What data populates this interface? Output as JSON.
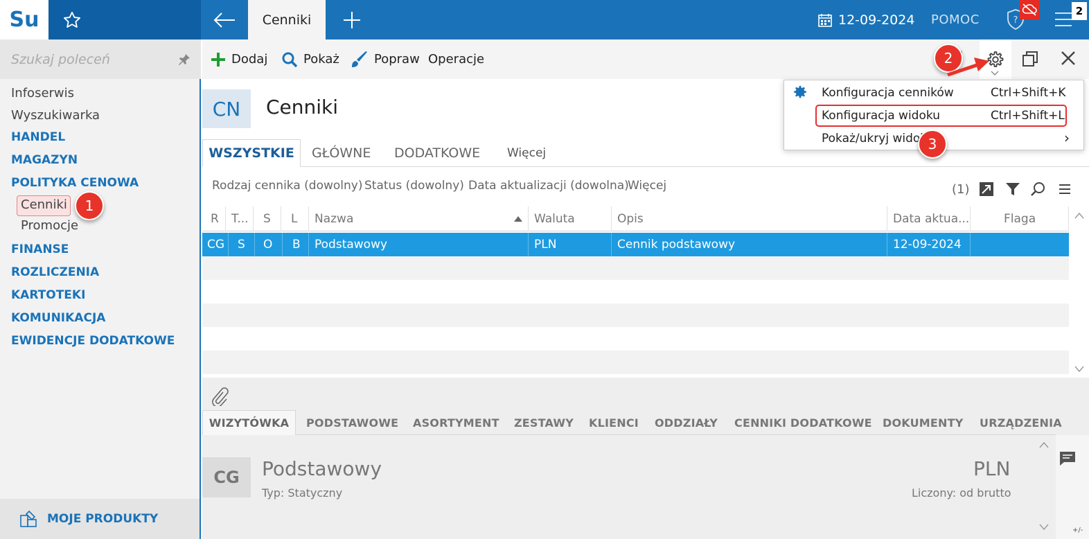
{
  "topbar": {
    "logo": "Su",
    "active_tab": "Cenniki",
    "date": "12-09-2024",
    "help": "POMOC",
    "badge_count": "2"
  },
  "sidebar": {
    "search_placeholder": "Szukaj poleceń",
    "items": [
      {
        "label": "Infoserwis"
      },
      {
        "label": "Wyszukiwarka"
      },
      {
        "label": "HANDEL"
      },
      {
        "label": "MAGAZYN"
      },
      {
        "label": "POLITYKA CENOWA"
      },
      {
        "label": "Cenniki"
      },
      {
        "label": "Promocje"
      },
      {
        "label": "FINANSE"
      },
      {
        "label": "ROZLICZENIA"
      },
      {
        "label": "KARTOTEKI"
      },
      {
        "label": "KOMUNIKACJA"
      },
      {
        "label": "EWIDENCJE DODATKOWE"
      }
    ],
    "products": "MOJE PRODUKTY"
  },
  "toolbar": {
    "add": "Dodaj",
    "show": "Pokaż",
    "edit": "Popraw",
    "operations": "Operacje"
  },
  "header": {
    "code": "CN",
    "title": "Cenniki"
  },
  "tabs": [
    "WSZYSTKIE",
    "GŁÓWNE",
    "DODATKOWE",
    "Więcej"
  ],
  "filters": {
    "items": [
      "Rodzaj cennika (dowolny)",
      "Status (dowolny)",
      "Data aktualizacji (dowolna)",
      "Więcej"
    ],
    "count": "(1)"
  },
  "grid": {
    "columns": [
      "R",
      "T...",
      "S",
      "L",
      "Nazwa",
      "Waluta",
      "Opis",
      "Data aktua...",
      "Flaga"
    ],
    "rows": [
      [
        "CG",
        "S",
        "O",
        "B",
        "Podstawowy",
        "PLN",
        "Cennik podstawowy",
        "12-09-2024",
        ""
      ]
    ]
  },
  "bottom_tabs": [
    "WIZYTÓWKA",
    "PODSTAWOWE",
    "ASORTYMENT",
    "ZESTAWY",
    "KLIENCI",
    "ODDZIAŁY",
    "CENNIKI DODATKOWE",
    "DOKUMENTY",
    "URZĄDZENIA"
  ],
  "card": {
    "code": "CG",
    "name": "Podstawowy",
    "type": "Typ: Statyczny",
    "currency": "PLN",
    "calc": "Liczony: od brutto"
  },
  "popup": {
    "items": [
      {
        "label": "Konfiguracja cenników",
        "shortcut": "Ctrl+Shift+K"
      },
      {
        "label": "Konfiguracja widoku",
        "shortcut": "Ctrl+Shift+L"
      },
      {
        "label": "Pokaż/ukryj widoki",
        "shortcut": "›"
      }
    ]
  },
  "callouts": [
    "1",
    "2",
    "3"
  ],
  "corner": "+/-",
  "colors": {
    "brand": "#1a73b8",
    "selection": "#1e9be0",
    "callout": "#e7332a"
  }
}
